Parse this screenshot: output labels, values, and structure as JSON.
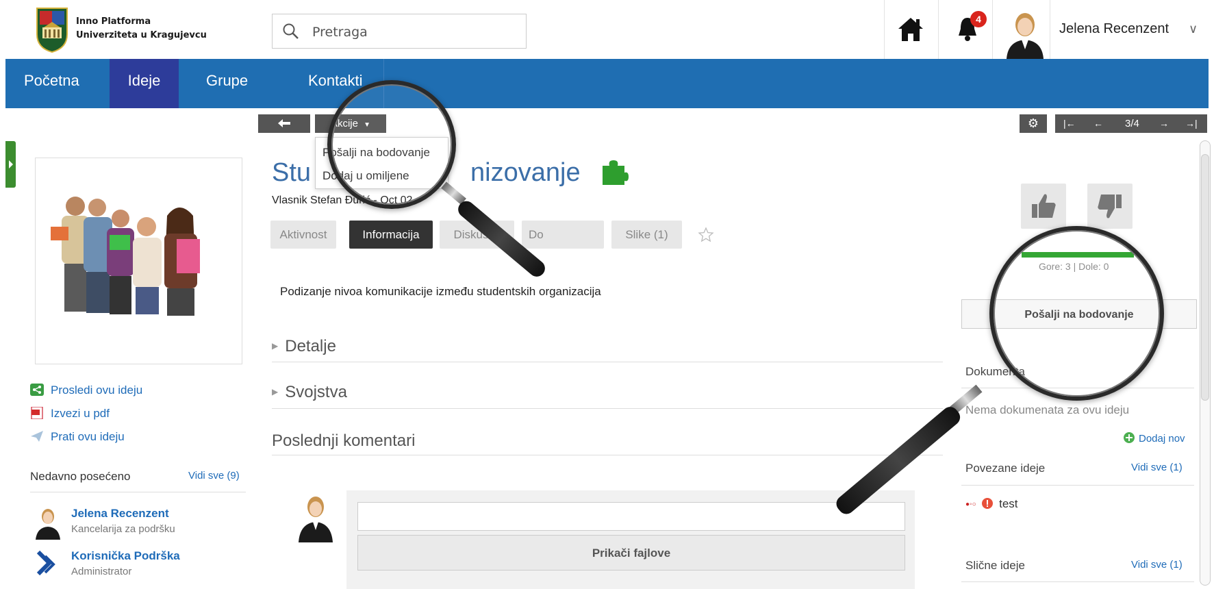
{
  "header": {
    "brand_line1": "Inno Platforma",
    "brand_line2": "Univerziteta u Kragujevcu",
    "search_placeholder": "Pretraga",
    "notification_count": "4",
    "user_name": "Jelena Recenzent"
  },
  "nav": {
    "items": [
      {
        "label": "Početna",
        "active": false
      },
      {
        "label": "Ideje",
        "active": true
      },
      {
        "label": "Grupe",
        "active": false
      },
      {
        "label": "Kontakti",
        "active": false
      }
    ]
  },
  "toolbar": {
    "actions_label": "Akcije",
    "actions_menu": [
      "Pošalji na bodovanje",
      "Dodaj u omiljene"
    ],
    "pager": "3/4"
  },
  "idea": {
    "title_left": "Stu",
    "title_right": "nizovanje",
    "owner": "Vlasnik Stefan Đurić - Oct 02",
    "tabs": [
      {
        "label": "Aktivnost",
        "active": false
      },
      {
        "label": "Informacija",
        "active": true
      },
      {
        "label": "Diskusija",
        "active": false
      },
      {
        "label": "Do",
        "active": false
      },
      {
        "label": "Slike (1)",
        "active": false
      }
    ],
    "description": "Podizanje nivoa komunikacije između studentskih organizacija",
    "sections": [
      "Detalje",
      "Svojstva"
    ],
    "comments_title": "Poslednji komentari",
    "attach_label": "Prikači fajlove"
  },
  "left": {
    "links": [
      "Prosledi ovu ideju",
      "Izvezi u pdf",
      "Prati ovu ideju"
    ],
    "recent_title": "Nedavno posećeno",
    "recent_all": "Vidi sve (9)",
    "people": [
      {
        "name": "Jelena Recenzent",
        "role": "Kancelarija za podršku"
      },
      {
        "name": "Korisnička Podrška",
        "role": "Administrator"
      }
    ]
  },
  "right": {
    "votes_up": 3,
    "votes_down": 0,
    "votes_label": "Gore: 3 | Dole: 0",
    "score_button": "Pošalji na bodovanje",
    "documents_title": "Dokumenta",
    "no_documents": "Nema dokumenata za ovu ideju",
    "add_new": "Dodaj nov",
    "related_title": "Povezane ideje",
    "related_all": "Vidi sve (1)",
    "related_item": "test",
    "similar_title": "Slične ideje",
    "similar_all": "Vidi sve (1)"
  },
  "colors": {
    "nav_bg": "#1f6eb2",
    "nav_active": "#2d3c9a",
    "link": "#1e6bb8",
    "title": "#3b6ea8",
    "vote_bar": "#2aa22a",
    "badge": "#d9241c"
  }
}
